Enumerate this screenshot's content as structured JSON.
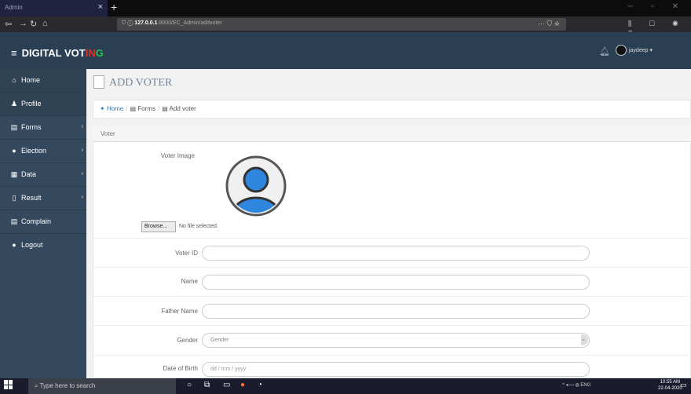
{
  "browser": {
    "tab_title": "Admin",
    "url_host": "127.0.0.1",
    "url_path": ":8000/EC_Admin/addvoter"
  },
  "app": {
    "brand_part1": "DIGITAL VOT",
    "brand_part2": "IN",
    "brand_part3": "G",
    "username": "jaydeep",
    "colors": {
      "brand_red": "#e63025",
      "brand_green": "#26c14a",
      "header": "#2a3f54",
      "sidebar": "#34495e"
    }
  },
  "sidebar": {
    "items": [
      {
        "label": "Home",
        "icon": "home-icon"
      },
      {
        "label": "Profile",
        "icon": "user-icon"
      },
      {
        "label": "Forms",
        "icon": "form-icon"
      },
      {
        "label": "Election",
        "icon": "election-icon"
      },
      {
        "label": "Data",
        "icon": "table-icon"
      },
      {
        "label": "Result",
        "icon": "result-icon"
      },
      {
        "label": "Complain",
        "icon": "complain-icon"
      },
      {
        "label": "Logout",
        "icon": "logout-icon"
      }
    ]
  },
  "page": {
    "title": "ADD VOTER",
    "breadcrumb": [
      "Home",
      "Forms",
      "Add voter"
    ],
    "panel_title": "Voter"
  },
  "form": {
    "voter_image_label": "Voter Image",
    "browse_label": "Browse...",
    "no_file": "No file selected.",
    "voter_id_label": "Voter ID",
    "name_label": "Name",
    "father_name_label": "Father Name",
    "gender_label": "Gender",
    "gender_selected": "Gender",
    "dob_label": "Date of Birth",
    "dob_placeholder": "dd / mm / yyyy"
  },
  "taskbar": {
    "search_placeholder": "Type here to search",
    "lang": "ENG",
    "time": "10:55 AM",
    "date": "22-04-2020"
  }
}
